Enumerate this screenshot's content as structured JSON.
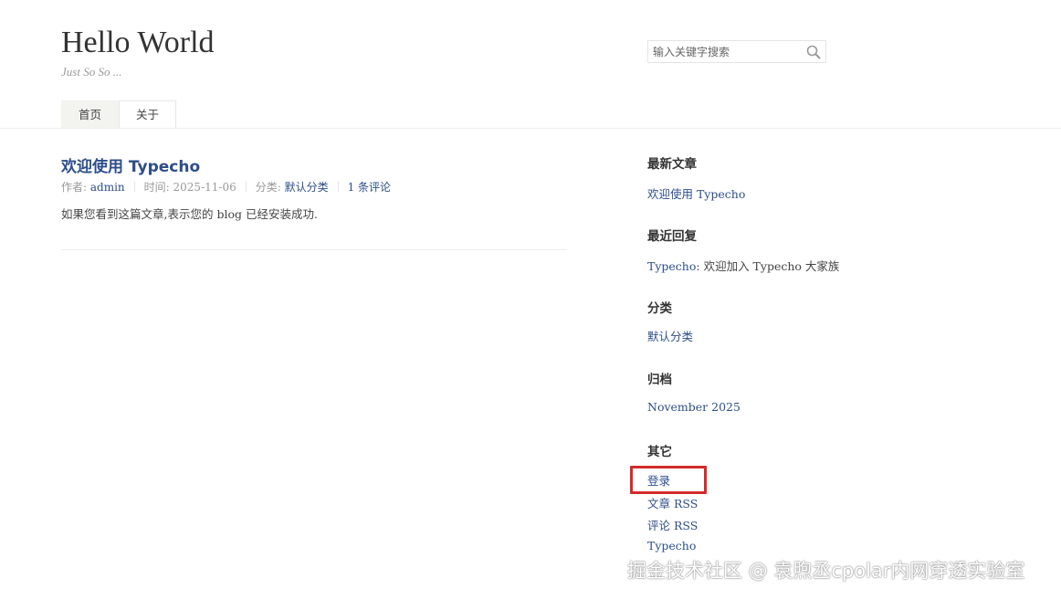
{
  "site": {
    "title": "Hello World",
    "description": "Just So So ..."
  },
  "search": {
    "placeholder": "输入关键字搜索",
    "icon": "search-icon"
  },
  "nav": {
    "items": [
      {
        "label": "首页",
        "current": true
      },
      {
        "label": "关于",
        "current": false
      }
    ]
  },
  "post": {
    "title": "欢迎使用 Typecho",
    "meta": {
      "author_label": "作者:",
      "author": "admin",
      "time_label": "时间:",
      "time": "2025-11-06",
      "category_label": "分类:",
      "category": "默认分类",
      "comments": "1 条评论"
    },
    "content": "如果您看到这篇文章,表示您的 blog 已经安装成功."
  },
  "sidebar": {
    "recent_posts": {
      "title": "最新文章",
      "items": [
        "欢迎使用 Typecho"
      ]
    },
    "recent_comments": {
      "title": "最近回复",
      "items": [
        {
          "author": "Typecho",
          "text": ": 欢迎加入 Typecho 大家族"
        }
      ]
    },
    "categories": {
      "title": "分类",
      "items": [
        "默认分类"
      ]
    },
    "archives": {
      "title": "归档",
      "items": [
        "November 2025"
      ]
    },
    "other": {
      "title": "其它",
      "items": [
        "登录",
        "文章 RSS",
        "评论 RSS",
        "Typecho"
      ]
    }
  },
  "highlight": {
    "color": "#d42a2a"
  },
  "colors": {
    "link": "#2c4e8a",
    "text": "#444444"
  },
  "watermark": "掘金技术社区 @ 袁煦丞cpolar内网穿透实验室"
}
